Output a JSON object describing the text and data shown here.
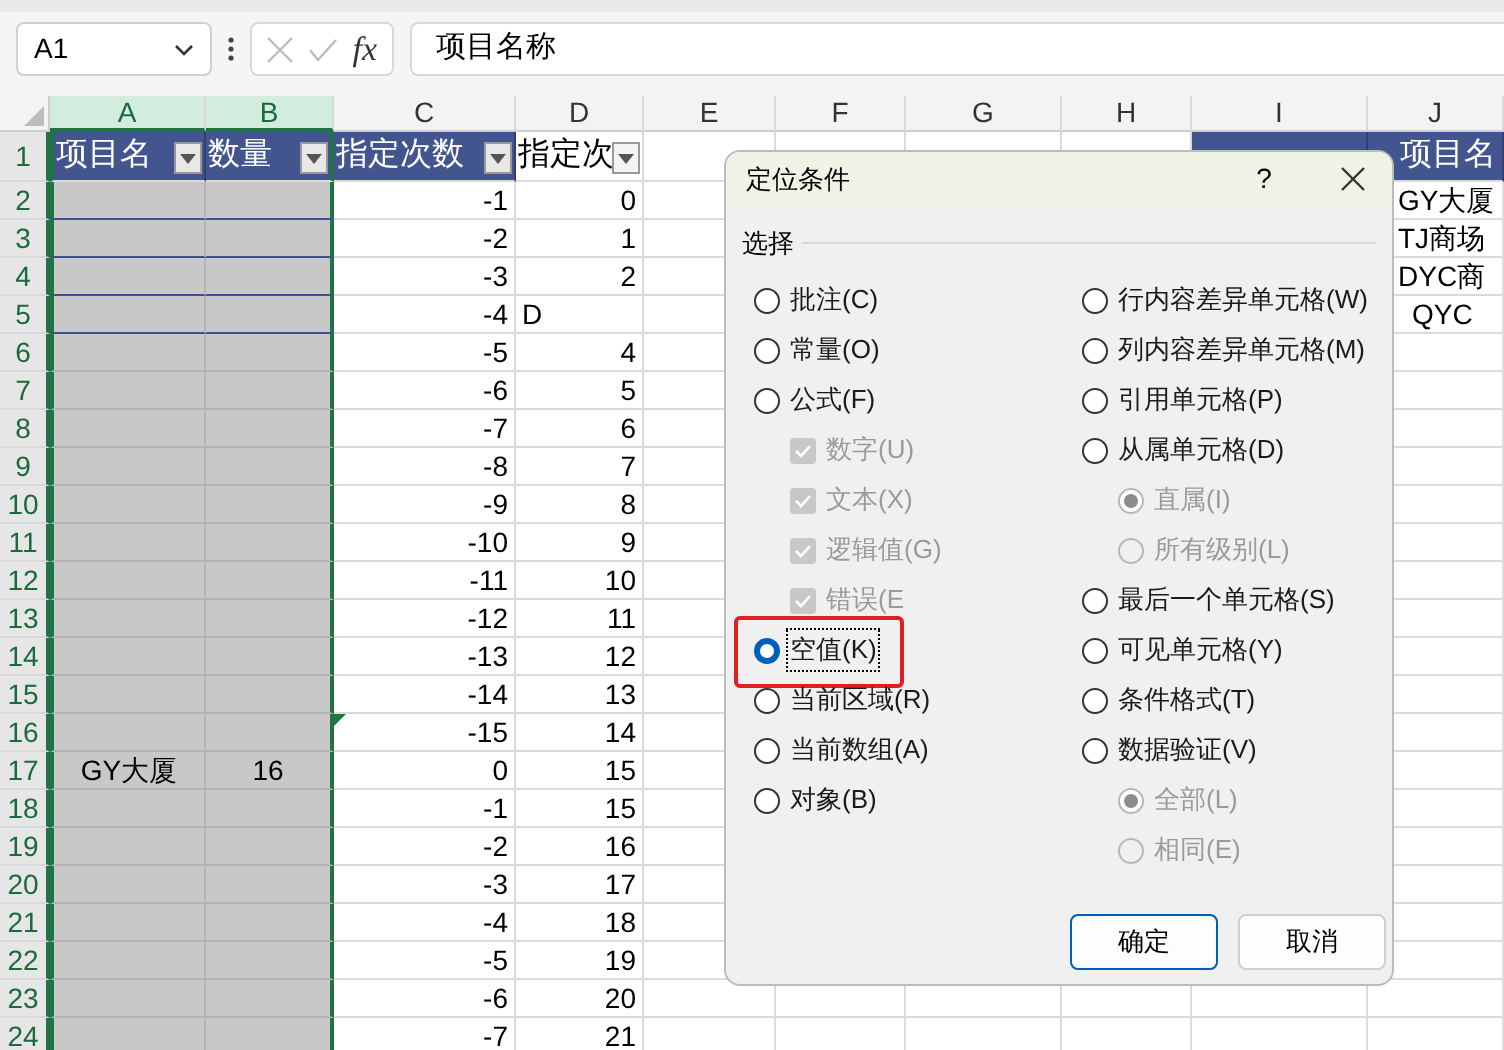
{
  "name_box": "A1",
  "formula_label": "fx",
  "formula": "项目名称",
  "columns": [
    {
      "label": "A",
      "selected": true
    },
    {
      "label": "B",
      "selected": true
    },
    {
      "label": "C",
      "selected": false
    },
    {
      "label": "D",
      "selected": false
    },
    {
      "label": "E",
      "selected": false
    },
    {
      "label": "F",
      "selected": false
    },
    {
      "label": "G",
      "selected": false
    },
    {
      "label": "H",
      "selected": false
    },
    {
      "label": "I",
      "selected": false
    },
    {
      "label": "J",
      "selected": false
    }
  ],
  "rows": [
    {
      "label": "1",
      "selected": true,
      "cells": [
        {
          "text": "项目名",
          "kind": "banded",
          "filter": true
        },
        {
          "text": "数量",
          "kind": "banded",
          "filter": true
        },
        {
          "text": "指定次数",
          "kind": "banded",
          "filter": true
        },
        {
          "text": "指定次",
          "kind": "plain",
          "filter": true
        },
        null,
        null,
        null,
        null,
        {
          "kind": "banded"
        },
        {
          "text": "项目名",
          "kind": "banded"
        }
      ]
    },
    {
      "label": "2",
      "selected": true,
      "cells": [
        null,
        null,
        "-1",
        "0",
        null,
        null,
        null,
        null,
        null,
        "GY大厦"
      ]
    },
    {
      "label": "3",
      "selected": true,
      "cells": [
        null,
        null,
        "-2",
        "1",
        null,
        null,
        null,
        null,
        null,
        "TJ商场"
      ]
    },
    {
      "label": "4",
      "selected": true,
      "cells": [
        null,
        null,
        "-3",
        "2",
        null,
        null,
        null,
        null,
        null,
        "DYC商"
      ]
    },
    {
      "label": "5",
      "selected": true,
      "cells": [
        null,
        null,
        "-4",
        {
          "text": "D",
          "kind": "text"
        },
        null,
        null,
        null,
        null,
        null,
        "QYC"
      ]
    },
    {
      "label": "6",
      "selected": true,
      "cells": [
        null,
        null,
        "-5",
        "4"
      ]
    },
    {
      "label": "7",
      "selected": true,
      "cells": [
        null,
        null,
        "-6",
        "5"
      ]
    },
    {
      "label": "8",
      "selected": true,
      "cells": [
        null,
        null,
        "-7",
        "6"
      ]
    },
    {
      "label": "9",
      "selected": true,
      "cells": [
        null,
        null,
        "-8",
        "7"
      ]
    },
    {
      "label": "10",
      "selected": true,
      "cells": [
        null,
        null,
        "-9",
        "8"
      ]
    },
    {
      "label": "11",
      "selected": true,
      "cells": [
        null,
        null,
        "-10",
        "9"
      ]
    },
    {
      "label": "12",
      "selected": true,
      "cells": [
        null,
        null,
        "-11",
        "10"
      ]
    },
    {
      "label": "13",
      "selected": true,
      "cells": [
        null,
        null,
        "-12",
        "11"
      ]
    },
    {
      "label": "14",
      "selected": true,
      "cells": [
        null,
        null,
        "-13",
        "12"
      ]
    },
    {
      "label": "15",
      "selected": true,
      "cells": [
        null,
        null,
        "-14",
        "13"
      ]
    },
    {
      "label": "16",
      "selected": true,
      "cells": [
        null,
        null,
        {
          "text": "-15",
          "flag": true
        },
        "14"
      ]
    },
    {
      "label": "17",
      "selected": true,
      "cells": [
        "GY大厦",
        "16",
        "0",
        "15"
      ]
    },
    {
      "label": "18",
      "selected": true,
      "cells": [
        null,
        null,
        "-1",
        "15"
      ]
    },
    {
      "label": "19",
      "selected": true,
      "cells": [
        null,
        null,
        "-2",
        "16"
      ]
    },
    {
      "label": "20",
      "selected": true,
      "cells": [
        null,
        null,
        "-3",
        "17"
      ]
    },
    {
      "label": "21",
      "selected": true,
      "cells": [
        null,
        null,
        "-4",
        "18"
      ]
    },
    {
      "label": "22",
      "selected": true,
      "cells": [
        null,
        null,
        "-5",
        "19"
      ]
    },
    {
      "label": "23",
      "selected": true,
      "cells": [
        null,
        null,
        "-6",
        "20"
      ]
    },
    {
      "label": "24",
      "selected": true,
      "cells": [
        null,
        null,
        "-7",
        "21"
      ]
    }
  ],
  "dialog": {
    "title": "定位条件",
    "help": "?",
    "group": "选择",
    "left": [
      {
        "kind": "radio",
        "label": "批注(C)",
        "selected": false,
        "highlighted": false
      },
      {
        "kind": "radio",
        "label": "常量(O)",
        "selected": false,
        "highlighted": false
      },
      {
        "kind": "radio",
        "label": "公式(F)",
        "selected": false,
        "highlighted": false,
        "children": [
          {
            "kind": "check",
            "label": "数字(U)",
            "checked": true,
            "disabled": true
          },
          {
            "kind": "check",
            "label": "文本(X)",
            "checked": true,
            "disabled": true
          },
          {
            "kind": "check",
            "label": "逻辑值(G)",
            "checked": true,
            "disabled": true
          },
          {
            "kind": "check",
            "label": "错误(E",
            "checked": true,
            "disabled": true
          }
        ]
      },
      {
        "kind": "radio",
        "label": "空值(K)",
        "selected": true,
        "highlighted": true
      },
      {
        "kind": "radio",
        "label": "当前区域(R)",
        "selected": false,
        "highlighted": false
      },
      {
        "kind": "radio",
        "label": "当前数组(A)",
        "selected": false,
        "highlighted": false
      },
      {
        "kind": "radio",
        "label": "对象(B)",
        "selected": false,
        "highlighted": false
      }
    ],
    "right": [
      {
        "kind": "radio",
        "label": "行内容差异单元格(W)",
        "selected": false,
        "highlighted": false
      },
      {
        "kind": "radio",
        "label": "列内容差异单元格(M)",
        "selected": false,
        "highlighted": false
      },
      {
        "kind": "radio",
        "label": "引用单元格(P)",
        "selected": false,
        "highlighted": false
      },
      {
        "kind": "radio",
        "label": "从属单元格(D)",
        "selected": false,
        "highlighted": false,
        "children": [
          {
            "kind": "radio",
            "label": "直属(I)",
            "selected": true,
            "disabled": true
          },
          {
            "kind": "radio",
            "label": "所有级别(L)",
            "selected": false,
            "disabled": true
          }
        ]
      },
      {
        "kind": "radio",
        "label": "最后一个单元格(S)",
        "selected": false,
        "highlighted": false
      },
      {
        "kind": "radio",
        "label": "可见单元格(Y)",
        "selected": false,
        "highlighted": false
      },
      {
        "kind": "radio",
        "label": "条件格式(T)",
        "selected": false,
        "highlighted": false
      },
      {
        "kind": "radio",
        "label": "数据验证(V)",
        "selected": false,
        "highlighted": false,
        "children": [
          {
            "kind": "radio",
            "label": "全部(L)",
            "selected": true,
            "disabled": true
          },
          {
            "kind": "radio",
            "label": "相同(E)",
            "selected": false,
            "disabled": true
          }
        ]
      }
    ],
    "buttons": [
      {
        "label": "确定",
        "primary": true
      },
      {
        "label": "取消",
        "primary": false
      }
    ]
  }
}
